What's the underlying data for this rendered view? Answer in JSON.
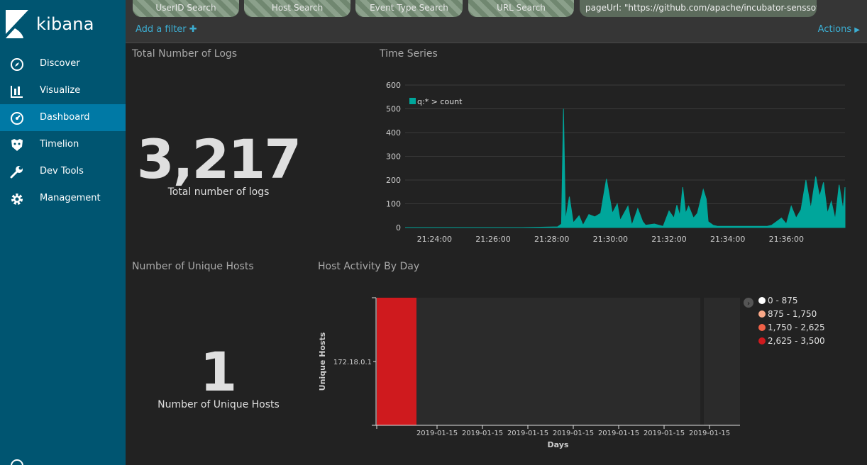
{
  "sidebar": {
    "brand": "kibana",
    "items": [
      {
        "label": "Discover",
        "icon": "compass-icon"
      },
      {
        "label": "Visualize",
        "icon": "bar-chart-icon"
      },
      {
        "label": "Dashboard",
        "icon": "dashboard-icon",
        "active": true
      },
      {
        "label": "Timelion",
        "icon": "timelion-icon"
      },
      {
        "label": "Dev Tools",
        "icon": "wrench-icon"
      },
      {
        "label": "Management",
        "icon": "gear-icon"
      }
    ]
  },
  "filterbar": {
    "pills": [
      "UserID Search",
      "Host Search",
      "Event Type Search",
      "URL Search",
      "pageUrl: \"https://github.com/apache/incubator-senssoft\""
    ],
    "add_filter": "Add a filter",
    "actions": "Actions"
  },
  "panels": {
    "logs": {
      "title": "Total Number of Logs",
      "value": "3,217",
      "label": "Total number of logs"
    },
    "timeseries": {
      "title": "Time Series"
    },
    "hosts": {
      "title": "Number of Unique Hosts",
      "value": "1",
      "label": "Number of Unique Hosts"
    },
    "activity": {
      "title": "Host Activity By Day"
    }
  },
  "chart_data": [
    {
      "type": "area",
      "legend": "q:* > count",
      "color": "#00a69b",
      "ylim": [
        0,
        600
      ],
      "yticks": [
        0,
        100,
        200,
        300,
        400,
        500,
        600
      ],
      "xticks": [
        "21:24:00",
        "21:26:00",
        "21:28:00",
        "21:30:00",
        "21:32:00",
        "21:34:00",
        "21:36:00"
      ],
      "x_range_minutes": [
        "21:23:00",
        "21:38:00"
      ],
      "grid": true,
      "points": [
        [
          "21:23:00",
          0
        ],
        [
          "21:27:00",
          0
        ],
        [
          "21:28:12",
          3
        ],
        [
          "21:28:20",
          15
        ],
        [
          "21:28:24",
          500
        ],
        [
          "21:28:28",
          30
        ],
        [
          "21:28:36",
          130
        ],
        [
          "21:28:44",
          20
        ],
        [
          "21:28:56",
          50
        ],
        [
          "21:29:04",
          10
        ],
        [
          "21:29:16",
          55
        ],
        [
          "21:29:28",
          45
        ],
        [
          "21:29:40",
          60
        ],
        [
          "21:29:52",
          205
        ],
        [
          "21:30:04",
          60
        ],
        [
          "21:30:14",
          100
        ],
        [
          "21:30:20",
          30
        ],
        [
          "21:30:36",
          90
        ],
        [
          "21:30:44",
          10
        ],
        [
          "21:30:56",
          80
        ],
        [
          "21:31:06",
          25
        ],
        [
          "21:31:12",
          10
        ],
        [
          "21:31:30",
          15
        ],
        [
          "21:31:48",
          5
        ],
        [
          "21:32:00",
          70
        ],
        [
          "21:32:10",
          40
        ],
        [
          "21:32:16",
          95
        ],
        [
          "21:32:22",
          50
        ],
        [
          "21:32:28",
          170
        ],
        [
          "21:32:34",
          60
        ],
        [
          "21:32:40",
          90
        ],
        [
          "21:32:50",
          40
        ],
        [
          "21:32:58",
          60
        ],
        [
          "21:33:10",
          160
        ],
        [
          "21:33:16",
          120
        ],
        [
          "21:33:20",
          25
        ],
        [
          "21:33:30",
          10
        ],
        [
          "21:33:40",
          5
        ],
        [
          "21:35:00",
          5
        ],
        [
          "21:35:20",
          5
        ],
        [
          "21:35:30",
          10
        ],
        [
          "21:35:40",
          25
        ],
        [
          "21:35:50",
          40
        ],
        [
          "21:36:00",
          15
        ],
        [
          "21:36:10",
          90
        ],
        [
          "21:36:20",
          40
        ],
        [
          "21:36:30",
          75
        ],
        [
          "21:36:40",
          200
        ],
        [
          "21:36:50",
          80
        ],
        [
          "21:37:00",
          215
        ],
        [
          "21:37:08",
          130
        ],
        [
          "21:37:16",
          190
        ],
        [
          "21:37:24",
          60
        ],
        [
          "21:37:32",
          110
        ],
        [
          "21:37:40",
          35
        ],
        [
          "21:37:48",
          180
        ],
        [
          "21:37:56",
          75
        ],
        [
          "21:38:00",
          170
        ]
      ]
    },
    {
      "type": "heatmap",
      "ylabel": "Unique Hosts",
      "xlabel": "Days",
      "rows": [
        "172.18.0.1"
      ],
      "xticks": [
        "2019-01-15",
        "2019-01-15",
        "2019-01-15",
        "2019-01-15",
        "2019-01-15",
        "2019-01-15",
        "2019-01-15"
      ],
      "cells": [
        {
          "row": "172.18.0.1",
          "value": 3217
        }
      ],
      "legend": [
        {
          "label": "0 - 875",
          "color": "#ffffff"
        },
        {
          "label": "875 - 1,750",
          "color": "#f9a888"
        },
        {
          "label": "1,750 - 2,625",
          "color": "#f06147"
        },
        {
          "label": "2,625 - 3,500",
          "color": "#cf1a1e"
        }
      ]
    }
  ]
}
